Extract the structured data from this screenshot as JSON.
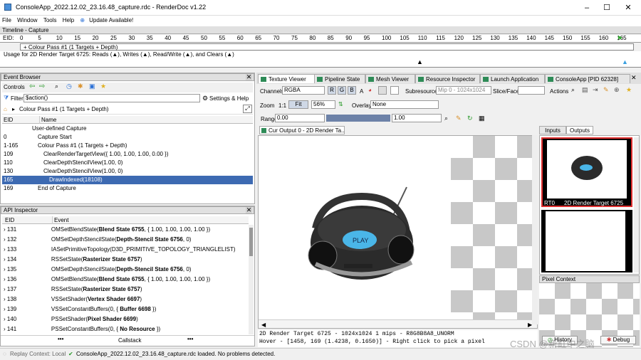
{
  "window": {
    "title": "ConsoleApp_2022.12.02_23.16.48_capture.rdc - RenderDoc v1.22",
    "minimize": "–",
    "maximize": "☐",
    "close": "✕"
  },
  "menu": [
    "File",
    "Window",
    "Tools",
    "Help"
  ],
  "update_label": "Update Available!",
  "timeline": {
    "title": "Timeline - Capture",
    "eid_label": "EID:",
    "ticks": [
      "0",
      "5",
      "10",
      "15",
      "20",
      "25",
      "30",
      "35",
      "40",
      "45",
      "50",
      "55",
      "60",
      "65",
      "70",
      "75",
      "80",
      "85",
      "90",
      "95",
      "100",
      "105",
      "110",
      "115",
      "120",
      "125",
      "130",
      "135",
      "140",
      "145",
      "150",
      "155",
      "160",
      "165"
    ],
    "pass_label": "+ Colour Pass #1 (1 Targets + Depth)",
    "usage_text": "Usage for 2D Render Target 6725: Reads (▲), Writes (▲), Read/Write (▲), and Clears (▲)"
  },
  "event_browser": {
    "title": "Event Browser",
    "controls_label": "Controls",
    "filter_label": "Filter",
    "filter_value": "$action()",
    "settings_label": "Settings & Help",
    "breadcrumb": "Colour Pass #1 (1 Targets + Depth)",
    "col_eid": "EID",
    "col_name": "Name",
    "rows": [
      {
        "eid": "",
        "name": "User-defined Capture",
        "indent": "0"
      },
      {
        "eid": "0",
        "name": "Capture Start",
        "indent": "1"
      },
      {
        "eid": "1-165",
        "name": "Colour Pass #1 (1 Targets + Depth)",
        "indent": "1"
      },
      {
        "eid": "109",
        "name": "ClearRenderTargetView({ 1.00, 1.00, 1.00, 0.00 })",
        "indent": "2"
      },
      {
        "eid": "110",
        "name": "ClearDepthStencilView(1.00, 0)",
        "indent": "2"
      },
      {
        "eid": "130",
        "name": "ClearDepthStencilView(1.00, 0)",
        "indent": "2"
      },
      {
        "eid": "165",
        "name": "DrawIndexed(18108)",
        "indent": "3"
      },
      {
        "eid": "169",
        "name": "End of Capture",
        "indent": "1"
      }
    ]
  },
  "api_inspector": {
    "title": "API Inspector",
    "col_eid": "EID",
    "col_event": "Event",
    "callstack": "Callstack",
    "rows": [
      {
        "eid": "131",
        "pre": "OMSetBlendState(",
        "bold": "Blend State 6755",
        "post": ", { 1.00, 1.00, 1.00, 1.00 })"
      },
      {
        "eid": "132",
        "pre": "OMSetDepthStencilState(",
        "bold": "Depth-Stencil State 6756",
        "post": ", 0)"
      },
      {
        "eid": "133",
        "pre": "IASetPrimitiveTopology(D3D_PRIMITIVE_TOPOLOGY_TRIANGLELIST)",
        "bold": "",
        "post": ""
      },
      {
        "eid": "134",
        "pre": "RSSetState(",
        "bold": "Rasterizer State 6757",
        "post": ")"
      },
      {
        "eid": "135",
        "pre": "OMSetDepthStencilState(",
        "bold": "Depth-Stencil State 6756",
        "post": ", 0)"
      },
      {
        "eid": "136",
        "pre": "OMSetBlendState(",
        "bold": "Blend State 6755",
        "post": ", { 1.00, 1.00, 1.00, 1.00 })"
      },
      {
        "eid": "137",
        "pre": "RSSetState(",
        "bold": "Rasterizer State 6757",
        "post": ")"
      },
      {
        "eid": "138",
        "pre": "VSSetShader(",
        "bold": "Vertex Shader 6697",
        "post": ")"
      },
      {
        "eid": "139",
        "pre": "VSSetConstantBuffers(0, { ",
        "bold": "Buffer 6698",
        "post": " })"
      },
      {
        "eid": "140",
        "pre": "PSSetShader(",
        "bold": "Pixel Shader 6699",
        "post": ")"
      },
      {
        "eid": "141",
        "pre": "PSSetConstantBuffers(0, { ",
        "bold": "No Resource",
        "post": " })"
      }
    ]
  },
  "tabs": [
    {
      "label": "Texture Viewer",
      "active": true
    },
    {
      "label": "Pipeline State"
    },
    {
      "label": "Mesh Viewer"
    },
    {
      "label": "Resource Inspector"
    },
    {
      "label": "Launch Application"
    },
    {
      "label": "ConsoleApp [PID 62328]"
    }
  ],
  "texture_viewer": {
    "channels_label": "Channels",
    "channels_value": "RGBA",
    "ch_r": "R",
    "ch_g": "G",
    "ch_b": "B",
    "ch_a": "A",
    "subresource_label": "Subresource",
    "mip_value": "Mip 0 - 1024x1024",
    "slice_label": "Slice/Face",
    "actions_label": "Actions",
    "zoom_label": "Zoom",
    "zoom_1to1": "1:1",
    "fit_label": "Fit",
    "zoom_value": "56%",
    "overlay_label": "Overlay",
    "overlay_value": "None",
    "range_label": "Range",
    "range_min": "0.00",
    "range_max": "1.00",
    "output_tab": "Cur Output 0 - 2D Render Ta...",
    "inputs_tab": "Inputs",
    "outputs_tab": "Outputs",
    "thumb_label": "RT0",
    "thumb_name": "2D Render Target 6725",
    "pixel_context": "Pixel Context",
    "history_btn": "History",
    "debug_btn": "Debug",
    "play_text": "PLAY",
    "status_line1": "2D Render Target 6725 - 1024x1024 1 mips - R8G8B8A8_UNORM",
    "status_line2": "Hover - [1458, 169 (1.4238, 0.1650)] - Right click to pick a pixel"
  },
  "statusbar": {
    "replay": "Replay Context: Local",
    "message": "ConsoleApp_2022.12.02_23.16.48_capture.rdc loaded. No problems detected."
  },
  "watermark": "CSDN @新缸中之脑",
  "colors": {
    "selection": "#3d6ab2",
    "accent": "#2e8b57",
    "thumb_border": "#e03030"
  }
}
